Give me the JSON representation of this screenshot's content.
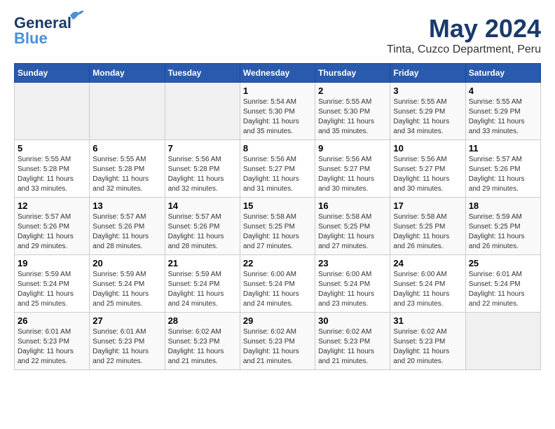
{
  "logo": {
    "line1": "General",
    "line2": "Blue"
  },
  "title": "May 2024",
  "subtitle": "Tinta, Cuzco Department, Peru",
  "days_header": [
    "Sunday",
    "Monday",
    "Tuesday",
    "Wednesday",
    "Thursday",
    "Friday",
    "Saturday"
  ],
  "weeks": [
    [
      {
        "day": "",
        "info": ""
      },
      {
        "day": "",
        "info": ""
      },
      {
        "day": "",
        "info": ""
      },
      {
        "day": "1",
        "info": "Sunrise: 5:54 AM\nSunset: 5:30 PM\nDaylight: 11 hours\nand 35 minutes."
      },
      {
        "day": "2",
        "info": "Sunrise: 5:55 AM\nSunset: 5:30 PM\nDaylight: 11 hours\nand 35 minutes."
      },
      {
        "day": "3",
        "info": "Sunrise: 5:55 AM\nSunset: 5:29 PM\nDaylight: 11 hours\nand 34 minutes."
      },
      {
        "day": "4",
        "info": "Sunrise: 5:55 AM\nSunset: 5:29 PM\nDaylight: 11 hours\nand 33 minutes."
      }
    ],
    [
      {
        "day": "5",
        "info": "Sunrise: 5:55 AM\nSunset: 5:28 PM\nDaylight: 11 hours\nand 33 minutes."
      },
      {
        "day": "6",
        "info": "Sunrise: 5:55 AM\nSunset: 5:28 PM\nDaylight: 11 hours\nand 32 minutes."
      },
      {
        "day": "7",
        "info": "Sunrise: 5:56 AM\nSunset: 5:28 PM\nDaylight: 11 hours\nand 32 minutes."
      },
      {
        "day": "8",
        "info": "Sunrise: 5:56 AM\nSunset: 5:27 PM\nDaylight: 11 hours\nand 31 minutes."
      },
      {
        "day": "9",
        "info": "Sunrise: 5:56 AM\nSunset: 5:27 PM\nDaylight: 11 hours\nand 30 minutes."
      },
      {
        "day": "10",
        "info": "Sunrise: 5:56 AM\nSunset: 5:27 PM\nDaylight: 11 hours\nand 30 minutes."
      },
      {
        "day": "11",
        "info": "Sunrise: 5:57 AM\nSunset: 5:26 PM\nDaylight: 11 hours\nand 29 minutes."
      }
    ],
    [
      {
        "day": "12",
        "info": "Sunrise: 5:57 AM\nSunset: 5:26 PM\nDaylight: 11 hours\nand 29 minutes."
      },
      {
        "day": "13",
        "info": "Sunrise: 5:57 AM\nSunset: 5:26 PM\nDaylight: 11 hours\nand 28 minutes."
      },
      {
        "day": "14",
        "info": "Sunrise: 5:57 AM\nSunset: 5:26 PM\nDaylight: 11 hours\nand 28 minutes."
      },
      {
        "day": "15",
        "info": "Sunrise: 5:58 AM\nSunset: 5:25 PM\nDaylight: 11 hours\nand 27 minutes."
      },
      {
        "day": "16",
        "info": "Sunrise: 5:58 AM\nSunset: 5:25 PM\nDaylight: 11 hours\nand 27 minutes."
      },
      {
        "day": "17",
        "info": "Sunrise: 5:58 AM\nSunset: 5:25 PM\nDaylight: 11 hours\nand 26 minutes."
      },
      {
        "day": "18",
        "info": "Sunrise: 5:59 AM\nSunset: 5:25 PM\nDaylight: 11 hours\nand 26 minutes."
      }
    ],
    [
      {
        "day": "19",
        "info": "Sunrise: 5:59 AM\nSunset: 5:24 PM\nDaylight: 11 hours\nand 25 minutes."
      },
      {
        "day": "20",
        "info": "Sunrise: 5:59 AM\nSunset: 5:24 PM\nDaylight: 11 hours\nand 25 minutes."
      },
      {
        "day": "21",
        "info": "Sunrise: 5:59 AM\nSunset: 5:24 PM\nDaylight: 11 hours\nand 24 minutes."
      },
      {
        "day": "22",
        "info": "Sunrise: 6:00 AM\nSunset: 5:24 PM\nDaylight: 11 hours\nand 24 minutes."
      },
      {
        "day": "23",
        "info": "Sunrise: 6:00 AM\nSunset: 5:24 PM\nDaylight: 11 hours\nand 23 minutes."
      },
      {
        "day": "24",
        "info": "Sunrise: 6:00 AM\nSunset: 5:24 PM\nDaylight: 11 hours\nand 23 minutes."
      },
      {
        "day": "25",
        "info": "Sunrise: 6:01 AM\nSunset: 5:24 PM\nDaylight: 11 hours\nand 22 minutes."
      }
    ],
    [
      {
        "day": "26",
        "info": "Sunrise: 6:01 AM\nSunset: 5:23 PM\nDaylight: 11 hours\nand 22 minutes."
      },
      {
        "day": "27",
        "info": "Sunrise: 6:01 AM\nSunset: 5:23 PM\nDaylight: 11 hours\nand 22 minutes."
      },
      {
        "day": "28",
        "info": "Sunrise: 6:02 AM\nSunset: 5:23 PM\nDaylight: 11 hours\nand 21 minutes."
      },
      {
        "day": "29",
        "info": "Sunrise: 6:02 AM\nSunset: 5:23 PM\nDaylight: 11 hours\nand 21 minutes."
      },
      {
        "day": "30",
        "info": "Sunrise: 6:02 AM\nSunset: 5:23 PM\nDaylight: 11 hours\nand 21 minutes."
      },
      {
        "day": "31",
        "info": "Sunrise: 6:02 AM\nSunset: 5:23 PM\nDaylight: 11 hours\nand 20 minutes."
      },
      {
        "day": "",
        "info": ""
      }
    ]
  ]
}
